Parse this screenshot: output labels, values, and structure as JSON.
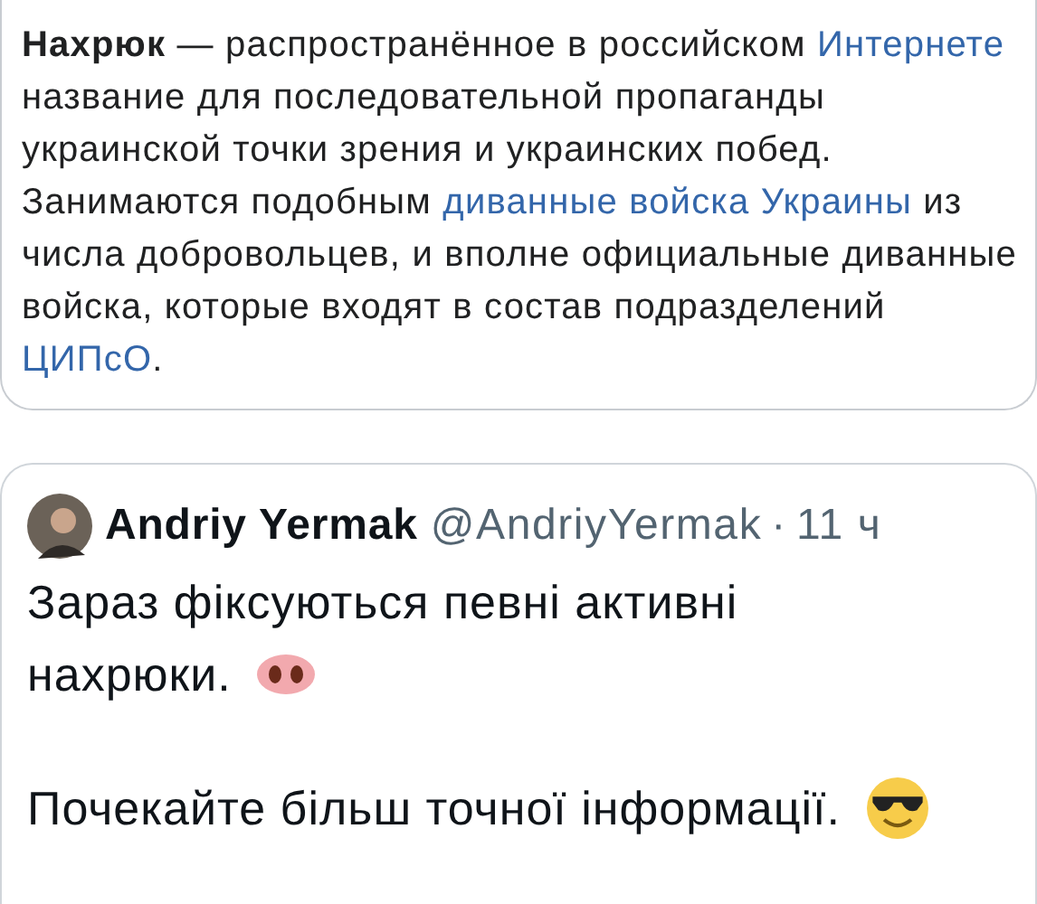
{
  "wiki_snippet": {
    "segments": [
      {
        "kind": "bold",
        "text": "Нахрюк"
      },
      {
        "kind": "text",
        "text": " — распространённое в российском "
      },
      {
        "kind": "link",
        "text": "Интернете"
      },
      {
        "kind": "text",
        "text": " название для последовательной пропаганды украинской точки зрения и украинских побед. Занимаются подобным "
      },
      {
        "kind": "link",
        "text": "диванные войска Украины"
      },
      {
        "kind": "text",
        "text": " из числа добровольцев, и вполне официальные диванные войска, которые входят в состав подразделений "
      },
      {
        "kind": "link",
        "text": "ЦИПсО"
      },
      {
        "kind": "text",
        "text": "."
      }
    ]
  },
  "tweet": {
    "name": "Andriy Yermak",
    "handle": "@AndriyYermak",
    "separator": "·",
    "time": "11 ч",
    "paragraphs": [
      {
        "lines": [
          "Зараз фіксуються певні активні",
          "нахрюки."
        ],
        "kind": "pig-nose"
      },
      {
        "lines": [
          "Почекайте більш точної інформації."
        ],
        "kind": "sunglasses"
      }
    ]
  }
}
